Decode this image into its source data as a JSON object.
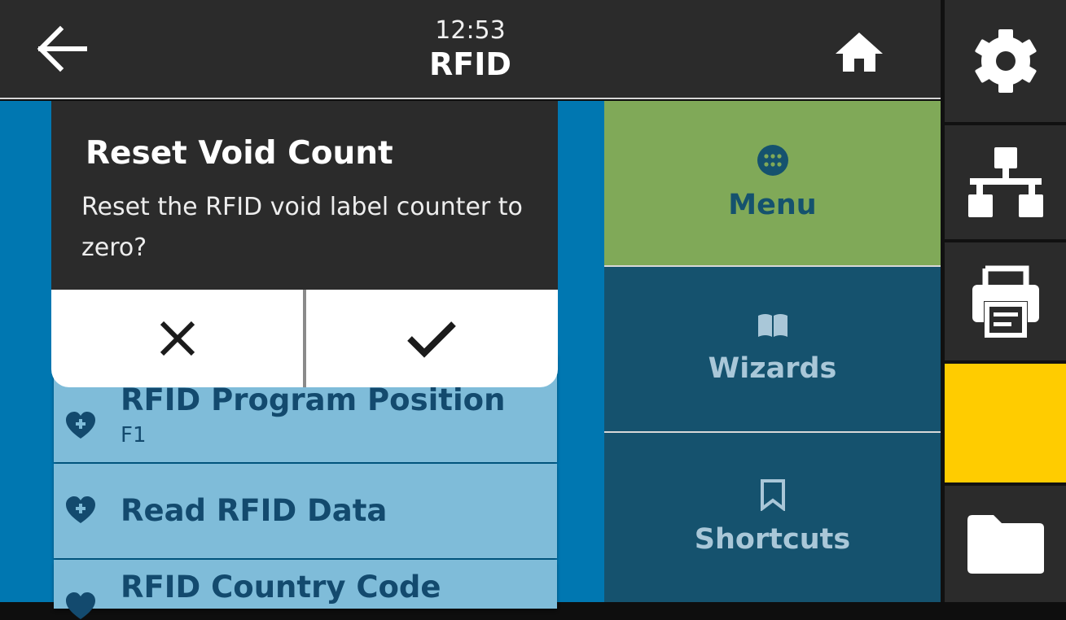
{
  "header": {
    "time": "12:53",
    "title": "RFID"
  },
  "dialog": {
    "title": "Reset Void Count",
    "message": "Reset the RFID void label counter to zero?"
  },
  "list": {
    "items": [
      {
        "label": "RFID Program Position",
        "value": "F1"
      },
      {
        "label": "Read RFID Data",
        "value": ""
      },
      {
        "label": "RFID Country Code",
        "value": ""
      }
    ]
  },
  "nav": {
    "menu_label": "Menu",
    "wizards_label": "Wizards",
    "shortcuts_label": "Shortcuts"
  },
  "colors": {
    "topbar": "#2b2b2b",
    "list_background": "#0077b1",
    "list_row": "#7fbcd9",
    "menu_tile": "#80a958",
    "nav_tile": "#15526e",
    "status_yellow": "#ffcc00"
  },
  "icons": [
    "back-arrow-icon",
    "home-icon",
    "gear-icon",
    "network-icon",
    "printer-icon",
    "folder-icon",
    "menu-grid-icon",
    "book-icon",
    "bookmark-icon",
    "heart-plus-icon",
    "close-icon",
    "checkmark-icon"
  ]
}
